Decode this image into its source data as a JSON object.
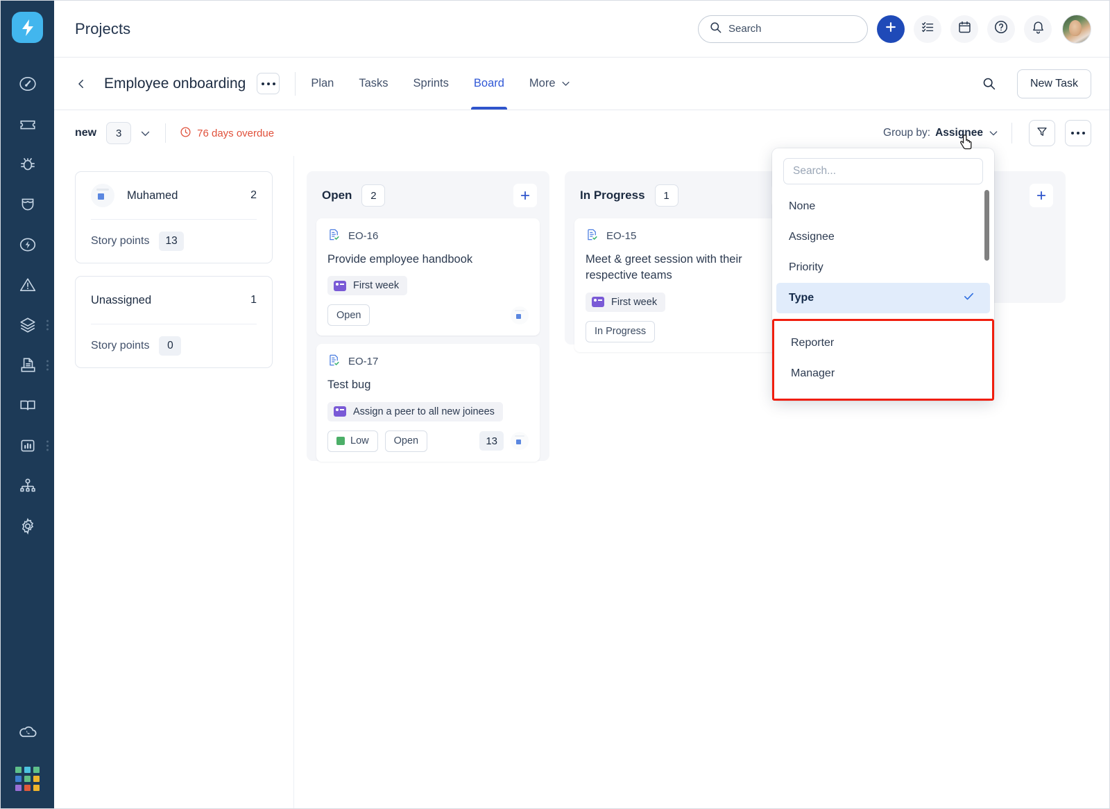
{
  "sidebar": {
    "logo": "bolt-logo",
    "items": [
      {
        "icon": "dashboard-icon",
        "name": "dashboard",
        "dots": false
      },
      {
        "icon": "ticket-icon",
        "name": "tickets",
        "dots": false
      },
      {
        "icon": "bug-icon",
        "name": "bugs",
        "dots": false
      },
      {
        "icon": "shield-icon",
        "name": "quality",
        "dots": false
      },
      {
        "icon": "flash-icon",
        "name": "automation",
        "dots": false
      },
      {
        "icon": "alert-icon",
        "name": "incidents",
        "dots": false
      },
      {
        "icon": "layers-icon",
        "name": "projects",
        "dots": true
      },
      {
        "icon": "document-tray-icon",
        "name": "documents",
        "dots": true
      },
      {
        "icon": "book-icon",
        "name": "knowledge-base",
        "dots": false
      },
      {
        "icon": "chart-icon",
        "name": "reports",
        "dots": true
      },
      {
        "icon": "org-chart-icon",
        "name": "teams",
        "dots": false
      },
      {
        "icon": "gear-icon",
        "name": "settings",
        "dots": false
      }
    ],
    "bottom": {
      "cloud": "cloud-phone-icon",
      "grid_colors": [
        "#5fc08a",
        "#4cc3e0",
        "#5fc08a",
        "#3f7fd1",
        "#62bf86",
        "#efb52c",
        "#9a6fd6",
        "#e05a3a",
        "#efb52c"
      ]
    }
  },
  "header": {
    "title": "Projects",
    "search": {
      "placeholder": "Search",
      "value": "",
      "icon": "search-icon"
    },
    "actions": [
      {
        "name": "add-button",
        "icon": "plus-icon"
      },
      {
        "name": "tasks-button",
        "icon": "checklist-icon"
      },
      {
        "name": "calendar-button",
        "icon": "calendar-icon"
      },
      {
        "name": "help-button",
        "icon": "question-circle-icon"
      },
      {
        "name": "notifications-button",
        "icon": "bell-icon"
      }
    ],
    "avatar": "user-avatar"
  },
  "project": {
    "back": "back-chevron-icon",
    "name": "Employee onboarding",
    "more": "more-options-icon",
    "tabs": [
      {
        "label": "Plan",
        "active": false
      },
      {
        "label": "Tasks",
        "active": false
      },
      {
        "label": "Sprints",
        "active": false
      },
      {
        "label": "Board",
        "active": true
      },
      {
        "label": "More",
        "active": false,
        "chevron": true
      }
    ],
    "search_icon": "search-icon",
    "new_task_label": "New Task"
  },
  "board_toolbar": {
    "sprint_name": "new",
    "sprint_count": "3",
    "overdue_text": "76 days overdue",
    "overdue_icon": "clock-icon",
    "group_by_label": "Group by:",
    "group_by_value": "Assignee",
    "filter_icon": "filter-icon",
    "more_icon": "more-options-icon"
  },
  "group_panel": [
    {
      "name": "Muhamed",
      "count": "2",
      "story_points_label": "Story points",
      "story_points": "13",
      "has_avatar": true
    },
    {
      "name": "Unassigned",
      "count": "1",
      "story_points_label": "Story points",
      "story_points": "0",
      "has_avatar": false
    }
  ],
  "lanes": [
    {
      "title": "Open",
      "count": "2",
      "add_icon": "plus-icon",
      "cards": [
        {
          "key": "EO-16",
          "key_icon": "task-doc-icon",
          "title": "Provide employee handbook",
          "epic": "First week",
          "epic_icon": "epic-icon",
          "chips": [
            {
              "label": "Open",
              "color": ""
            }
          ],
          "story_points": "",
          "avatar": "assignee-avatar"
        },
        {
          "key": "EO-17",
          "key_icon": "task-doc-icon",
          "title": "Test bug",
          "epic": "Assign a peer to all new joinees",
          "epic_icon": "epic-icon",
          "chips": [
            {
              "label": "Low",
              "color": "#4caf68"
            },
            {
              "label": "Open",
              "color": ""
            }
          ],
          "story_points": "13",
          "avatar": "assignee-avatar"
        }
      ]
    },
    {
      "title": "In Progress",
      "count": "1",
      "add_icon": "plus-icon",
      "cards": [
        {
          "key": "EO-15",
          "key_icon": "task-doc-icon",
          "title": "Meet & greet session with their respective teams",
          "epic": "First week",
          "epic_icon": "epic-icon",
          "chips": [
            {
              "label": "In Progress",
              "color": ""
            }
          ],
          "story_points": "",
          "avatar": ""
        }
      ]
    },
    {
      "title": "",
      "count": "",
      "add_icon": "plus-icon",
      "cards": []
    }
  ],
  "dropdown": {
    "search_placeholder": "Search...",
    "items": [
      {
        "label": "None",
        "selected": false,
        "highlighted": false
      },
      {
        "label": "Assignee",
        "selected": false,
        "highlighted": false
      },
      {
        "label": "Priority",
        "selected": false,
        "highlighted": false
      },
      {
        "label": "Type",
        "selected": true,
        "highlighted": false,
        "check_icon": "check-icon"
      }
    ],
    "highlighted_items": [
      {
        "label": "Reporter"
      },
      {
        "label": "Manager"
      }
    ],
    "highlight_color": "#f01e0e"
  },
  "colors": {
    "rail_bg": "#1d3a57",
    "accent": "#2f55cc",
    "logo_bg": "#42b6ee",
    "overdue": "#e0503a",
    "selected_row": "#e1ecfb",
    "lane_bg": "#f5f6f9"
  }
}
